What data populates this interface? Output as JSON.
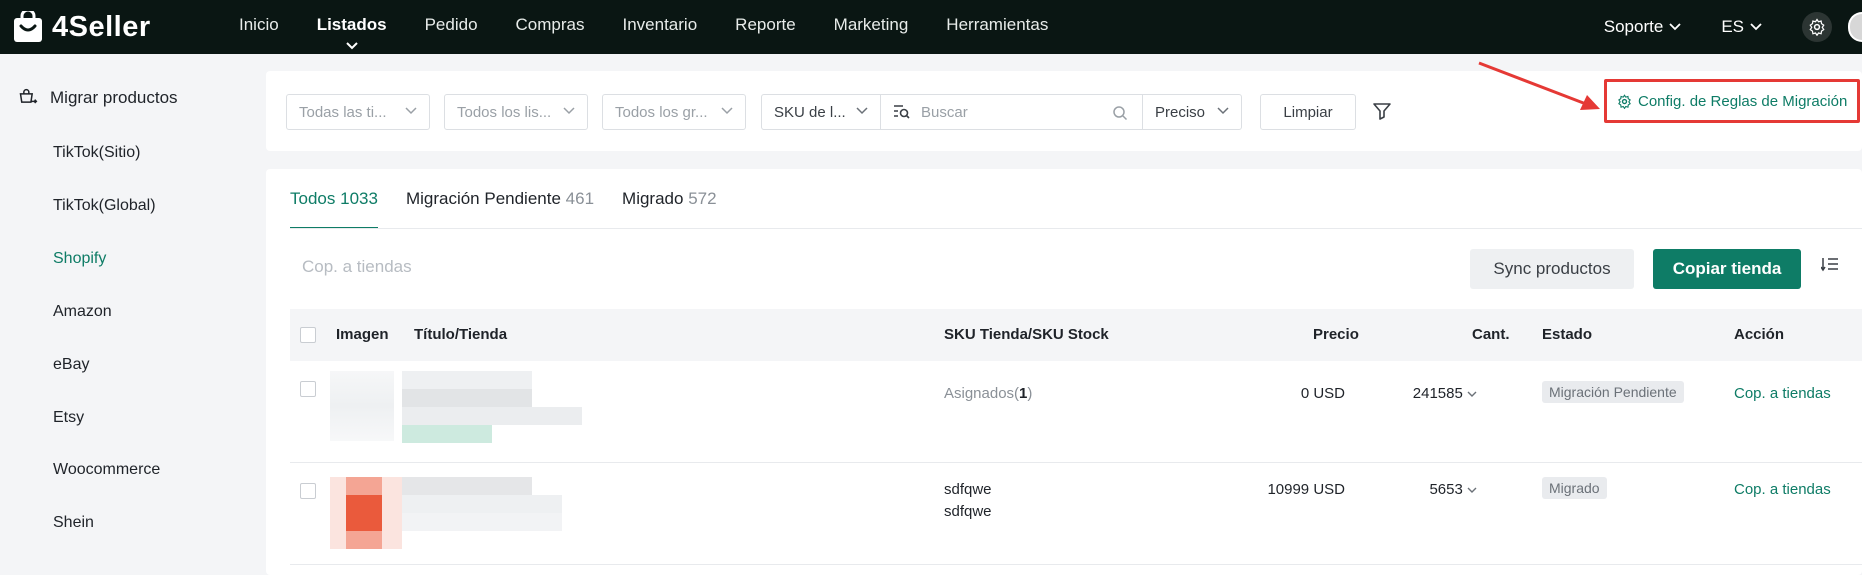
{
  "brand": {
    "name": "4Seller"
  },
  "nav": {
    "items": [
      "Inicio",
      "Listados",
      "Pedido",
      "Compras",
      "Inventario",
      "Reporte",
      "Marketing",
      "Herramientas"
    ],
    "active": "Listados",
    "support": "Soporte",
    "language": "ES"
  },
  "sidebar": {
    "title": "Migrar productos",
    "items": [
      "TikTok(Sitio)",
      "TikTok(Global)",
      "Shopify",
      "Amazon",
      "eBay",
      "Etsy",
      "Woocommerce",
      "Shein"
    ],
    "active": "Shopify"
  },
  "filters": {
    "store_type": "Todas las ti...",
    "listing": "Todos los lis...",
    "group": "Todos los gr...",
    "sku_field": "SKU de l...",
    "search_placeholder": "Buscar",
    "match_mode": "Preciso",
    "clear_label": "Limpiar",
    "config_label": "Config. de Reglas de Migración"
  },
  "tabs": [
    {
      "label": "Todos",
      "count": "1033"
    },
    {
      "label": "Migración Pendiente",
      "count": "461"
    },
    {
      "label": "Migrado",
      "count": "572"
    }
  ],
  "toolbar": {
    "copy_hint": "Cop. a tiendas",
    "sync_label": "Sync productos",
    "copy_store_label": "Copiar tienda"
  },
  "table": {
    "headers": {
      "image": "Imagen",
      "title": "Título/Tienda",
      "sku": "SKU Tienda/SKU Stock",
      "price": "Precio",
      "qty": "Cant.",
      "status": "Estado",
      "action": "Acción"
    },
    "rows": [
      {
        "sku_line1_prefix": "Asignados(",
        "sku_line1_count": "1",
        "sku_line1_suffix": ")",
        "sku_line2": "",
        "price": "0 USD",
        "qty": "241585",
        "status": "Migración Pendiente",
        "action": "Cop. a tiendas"
      },
      {
        "sku_line1_prefix": "sdfqwe",
        "sku_line1_count": "",
        "sku_line1_suffix": "",
        "sku_line2": "sdfqwe",
        "price": "10999 USD",
        "qty": "5653",
        "status": "Migrado",
        "action": "Cop. a tiendas"
      }
    ]
  },
  "colors": {
    "accent": "#0e7c66",
    "topbar": "#0a1613",
    "highlight": "#e53935"
  }
}
